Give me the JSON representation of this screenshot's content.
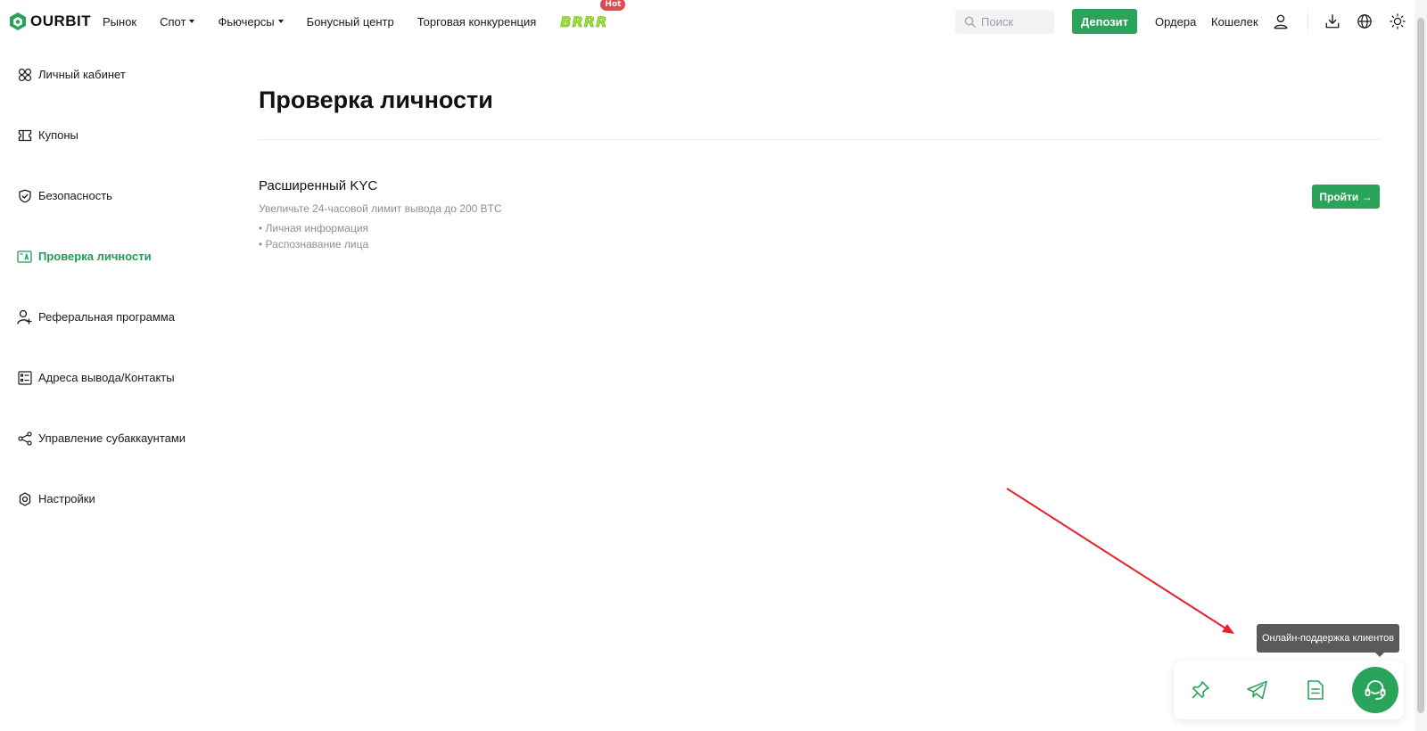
{
  "brand": {
    "name": "OURBIT",
    "color": "#2aa45b"
  },
  "nav": {
    "items": [
      {
        "label": "Рынок",
        "has_dropdown": false
      },
      {
        "label": "Спот",
        "has_dropdown": true
      },
      {
        "label": "Фьючерсы",
        "has_dropdown": true
      },
      {
        "label": "Бонусный центр",
        "has_dropdown": false
      },
      {
        "label": "Торговая конкуренция",
        "has_dropdown": false
      }
    ],
    "promo": {
      "label": "BRRR",
      "badge": "Hot"
    }
  },
  "header": {
    "search_placeholder": "Поиск",
    "deposit_label": "Депозит",
    "orders_label": "Ордера",
    "wallet_label": "Кошелек",
    "icons": [
      "user-icon",
      "download-icon",
      "globe-icon",
      "sun-icon"
    ]
  },
  "sidebar": {
    "items": [
      {
        "label": "Личный кабинет",
        "icon": "dashboard-icon",
        "active": false
      },
      {
        "label": "Купоны",
        "icon": "coupon-icon",
        "active": false
      },
      {
        "label": "Безопасность",
        "icon": "shield-icon",
        "active": false
      },
      {
        "label": "Проверка личности",
        "icon": "id-card-icon",
        "active": true
      },
      {
        "label": "Реферальная программа",
        "icon": "user-plus-icon",
        "active": false
      },
      {
        "label": "Адреса вывода/Контакты",
        "icon": "address-book-icon",
        "active": false
      },
      {
        "label": "Управление субаккаунтами",
        "icon": "share-nodes-icon",
        "active": false
      },
      {
        "label": "Настройки",
        "icon": "gear-icon",
        "active": false
      }
    ]
  },
  "main": {
    "title": "Проверка личности",
    "kyc": {
      "title": "Расширенный KYC",
      "description": "Увеличьте 24-часовой лимит вывода до 200 BTC",
      "bullets": [
        "• Личная информация",
        "• Распознавание лица"
      ],
      "button_label": "Пройти →"
    }
  },
  "floating": {
    "tooltip": "Онлайн-поддержка клиентов",
    "buttons": [
      "pin-icon",
      "telegram-icon",
      "document-icon",
      "headset-icon"
    ]
  },
  "colors": {
    "accent": "#2aa45b",
    "active_text": "#1f9d55",
    "hot": "#e5484d",
    "annotation": "#e8202a"
  }
}
